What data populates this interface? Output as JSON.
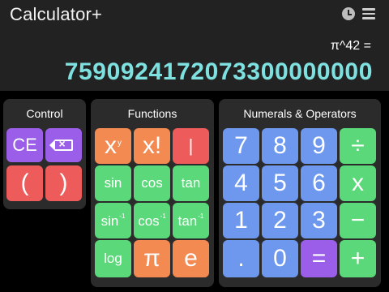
{
  "app": {
    "title": "Calculator+"
  },
  "header": {
    "history_icon": "history-icon",
    "menu_icon": "menu-icon"
  },
  "display": {
    "expression": "π^42 =",
    "result": "7590924172073300000000"
  },
  "panels": {
    "control": {
      "title": "Control",
      "keys": {
        "clear": "CE",
        "backspace_icon": "backspace-icon",
        "open_paren": "(",
        "close_paren": ")"
      }
    },
    "functions": {
      "title": "Functions",
      "keys": {
        "power_base": "x",
        "power_exp": "y",
        "factorial": "x!",
        "abs": "|",
        "sin": "sin",
        "cos": "cos",
        "tan": "tan",
        "asin_base": "sin",
        "asin_sup": "-1",
        "acos_base": "cos",
        "acos_sup": "-1",
        "atan_base": "tan",
        "atan_sup": "-1",
        "log": "log",
        "pi": "π",
        "e": "e"
      }
    },
    "numerals": {
      "title": "Numerals & Operators",
      "keys": {
        "n7": "7",
        "n8": "8",
        "n9": "9",
        "divide": "÷",
        "n4": "4",
        "n5": "5",
        "n6": "6",
        "multiply": "x",
        "n1": "1",
        "n2": "2",
        "n3": "3",
        "minus": "−",
        "dot": ".",
        "n0": "0",
        "equals": "=",
        "plus": "+"
      }
    }
  },
  "colors": {
    "purple": "#9a5ee8",
    "red": "#ee5b5b",
    "orange": "#f28a52",
    "green": "#5bd97a",
    "blue": "#6e98ee",
    "result_text": "#7fe0e0"
  }
}
